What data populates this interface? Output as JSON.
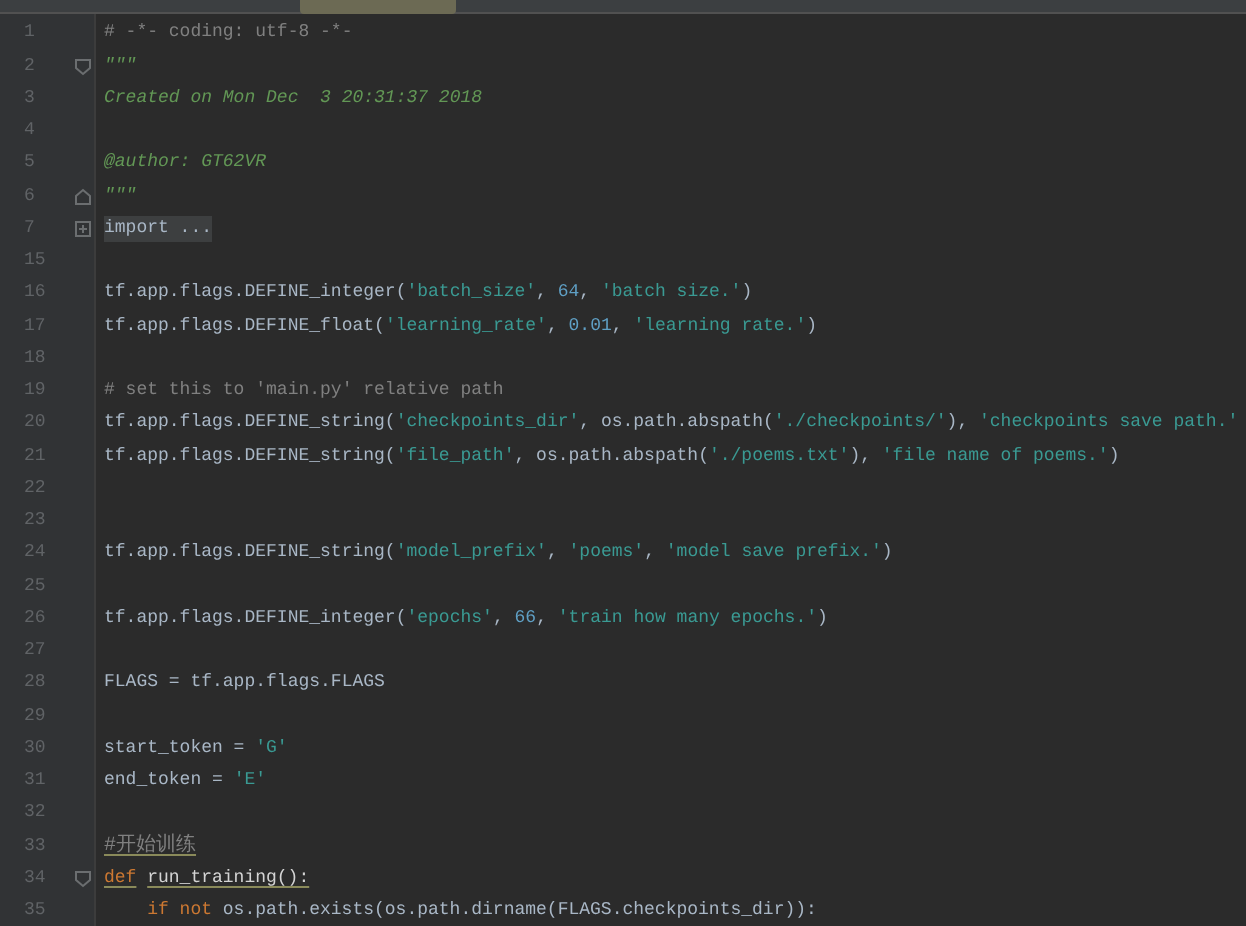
{
  "editor_tab": {
    "visible": true
  },
  "lines": [
    {
      "number": "1",
      "tokens": [
        {
          "kind": "comment",
          "text": "# -*- coding: utf-8 -*-"
        }
      ]
    },
    {
      "number": "2",
      "fold_open": true,
      "tokens": [
        {
          "kind": "docstring",
          "text": "\"\"\""
        }
      ]
    },
    {
      "number": "3",
      "tokens": [
        {
          "kind": "docstring",
          "text": "Created on Mon Dec  3 20:31:37 2018"
        }
      ]
    },
    {
      "number": "4"
    },
    {
      "number": "5",
      "tokens": [
        {
          "kind": "docstring",
          "text": "@author: GT62VR"
        }
      ]
    },
    {
      "number": "6",
      "fold_close": true,
      "tokens": [
        {
          "kind": "docstring",
          "text": "\"\"\""
        }
      ]
    },
    {
      "number": "7",
      "folded": true,
      "tokens": [
        {
          "kind": "folded",
          "text": "import ..."
        }
      ]
    },
    {
      "number": "15"
    },
    {
      "number": "16",
      "tokens": [
        {
          "kind": "plain",
          "text": "tf.app.flags.DEFINE_integer("
        },
        {
          "kind": "string",
          "text": "'batch_size'"
        },
        {
          "kind": "plain",
          "text": ", "
        },
        {
          "kind": "number",
          "text": "64"
        },
        {
          "kind": "plain",
          "text": ", "
        },
        {
          "kind": "string",
          "text": "'batch size.'"
        },
        {
          "kind": "plain",
          "text": ")"
        }
      ]
    },
    {
      "number": "17",
      "tokens": [
        {
          "kind": "plain",
          "text": "tf.app.flags.DEFINE_float("
        },
        {
          "kind": "string",
          "text": "'learning_rate'"
        },
        {
          "kind": "plain",
          "text": ", "
        },
        {
          "kind": "number",
          "text": "0.01"
        },
        {
          "kind": "plain",
          "text": ", "
        },
        {
          "kind": "string",
          "text": "'learning rate.'"
        },
        {
          "kind": "plain",
          "text": ")"
        }
      ]
    },
    {
      "number": "18"
    },
    {
      "number": "19",
      "tokens": [
        {
          "kind": "comment",
          "text": "# set this to 'main.py' relative path"
        }
      ]
    },
    {
      "number": "20",
      "tokens": [
        {
          "kind": "plain",
          "text": "tf.app.flags.DEFINE_string("
        },
        {
          "kind": "string",
          "text": "'checkpoints_dir'"
        },
        {
          "kind": "plain",
          "text": ", os.path.abspath("
        },
        {
          "kind": "string",
          "text": "'./checkpoints/'"
        },
        {
          "kind": "plain",
          "text": "), "
        },
        {
          "kind": "string",
          "text": "'checkpoints save path.'"
        }
      ]
    },
    {
      "number": "21",
      "tokens": [
        {
          "kind": "plain",
          "text": "tf.app.flags.DEFINE_string("
        },
        {
          "kind": "string",
          "text": "'file_path'"
        },
        {
          "kind": "plain",
          "text": ", os.path.abspath("
        },
        {
          "kind": "string",
          "text": "'./poems.txt'"
        },
        {
          "kind": "plain",
          "text": "), "
        },
        {
          "kind": "string",
          "text": "'file name of poems.'"
        },
        {
          "kind": "plain",
          "text": ")"
        }
      ]
    },
    {
      "number": "22"
    },
    {
      "number": "23"
    },
    {
      "number": "24",
      "tokens": [
        {
          "kind": "plain",
          "text": "tf.app.flags.DEFINE_string("
        },
        {
          "kind": "string",
          "text": "'model_prefix'"
        },
        {
          "kind": "plain",
          "text": ", "
        },
        {
          "kind": "string",
          "text": "'poems'"
        },
        {
          "kind": "plain",
          "text": ", "
        },
        {
          "kind": "string",
          "text": "'model save prefix.'"
        },
        {
          "kind": "plain",
          "text": ")"
        }
      ]
    },
    {
      "number": "25"
    },
    {
      "number": "26",
      "tokens": [
        {
          "kind": "plain",
          "text": "tf.app.flags.DEFINE_integer("
        },
        {
          "kind": "string",
          "text": "'epochs'"
        },
        {
          "kind": "plain",
          "text": ", "
        },
        {
          "kind": "number",
          "text": "66"
        },
        {
          "kind": "plain",
          "text": ", "
        },
        {
          "kind": "string",
          "text": "'train how many epochs.'"
        },
        {
          "kind": "plain",
          "text": ")"
        }
      ]
    },
    {
      "number": "27"
    },
    {
      "number": "28",
      "tokens": [
        {
          "kind": "plain",
          "text": "FLAGS = tf.app.flags.FLAGS"
        }
      ]
    },
    {
      "number": "29"
    },
    {
      "number": "30",
      "tokens": [
        {
          "kind": "plain",
          "text": "start_token = "
        },
        {
          "kind": "string",
          "text": "'G'"
        }
      ]
    },
    {
      "number": "31",
      "tokens": [
        {
          "kind": "plain",
          "text": "end_token = "
        },
        {
          "kind": "string",
          "text": "'E'"
        }
      ]
    },
    {
      "number": "32"
    },
    {
      "number": "33",
      "tokens": [
        {
          "kind": "comment",
          "text": "#开始训练",
          "underline": true
        }
      ]
    },
    {
      "number": "34",
      "fold_open": true,
      "tokens": [
        {
          "kind": "keyword",
          "text": "def",
          "underline": true
        },
        {
          "kind": "funcname",
          "text": "run_training():",
          "underline": true,
          "space_before": true
        }
      ]
    },
    {
      "number": "35",
      "indented": true,
      "tokens": [
        {
          "kind": "keyword",
          "text": "if not"
        },
        {
          "kind": "plain",
          "text": "os.path.exists(os.path.dirname(FLAGS.checkpoints_dir)):",
          "space_before": true
        }
      ]
    }
  ]
}
